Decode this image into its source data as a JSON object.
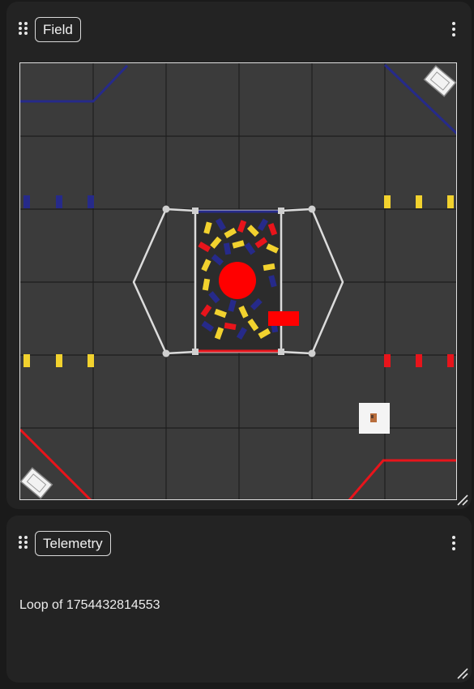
{
  "field_panel": {
    "title": "Field",
    "icons": {
      "drag": "drag-handle-icon",
      "menu": "kebab-menu-icon",
      "resize": "resize-icon"
    }
  },
  "telemetry_panel": {
    "title": "Telemetry",
    "lines": [
      "Loop of 1754432814553"
    ],
    "icons": {
      "drag": "drag-handle-icon",
      "menu": "kebab-menu-icon",
      "resize": "resize-icon"
    }
  },
  "colors": {
    "background": "#1a1a1a",
    "panel": "#232323",
    "field_tile": "#3b3b3b",
    "alliance_red": "#e8141b",
    "alliance_blue": "#262a8a",
    "sample_yellow": "#f2d22e"
  }
}
